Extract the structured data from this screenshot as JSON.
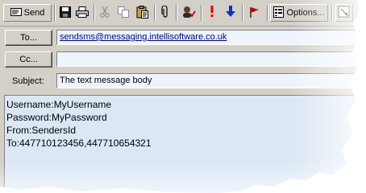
{
  "toolbar": {
    "send_label": "Send",
    "options_label": "Options...",
    "icons": [
      "send-icon",
      "save-icon",
      "print-icon",
      "cut-icon",
      "copy-icon",
      "paste-icon",
      "attach-icon",
      "check-names-icon",
      "importance-high-icon",
      "importance-low-icon",
      "flag-icon",
      "options-icon",
      "help-icon"
    ]
  },
  "header": {
    "to_button": "To...",
    "to_value": "sendsms@messaging.intellisoftware.co.uk",
    "cc_button": "Cc...",
    "cc_value": "",
    "subject_label": "Subject:",
    "subject_value": "The text message body"
  },
  "body": {
    "lines": [
      "Username:MyUsername",
      "Password:MyPassword",
      "From:SendersId",
      "To:447710123456,447710654321"
    ]
  },
  "colors": {
    "window_face": "#d4d0c8",
    "body_background": "#dbe7f5",
    "field_background": "#eef4fb",
    "link_color": "#00007a",
    "importance_high": "#e00000",
    "importance_low": "#1030c0"
  }
}
